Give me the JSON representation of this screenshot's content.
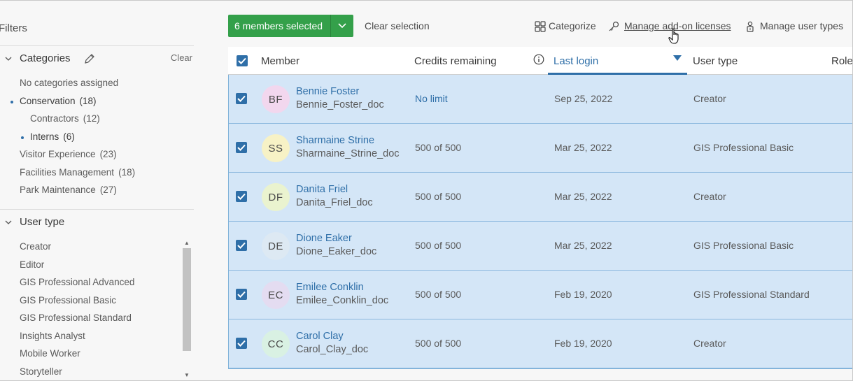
{
  "sidebar": {
    "filters_title": "Filters",
    "categories": {
      "title": "Categories",
      "clear": "Clear",
      "items": [
        {
          "label": "No categories assigned",
          "count": ""
        },
        {
          "label": "Conservation",
          "count": "(18)"
        },
        {
          "label": "Contractors",
          "count": "(12)"
        },
        {
          "label": "Interns",
          "count": "(6)"
        },
        {
          "label": "Visitor Experience",
          "count": "(23)"
        },
        {
          "label": "Facilities Management",
          "count": "(18)"
        },
        {
          "label": "Park Maintenance",
          "count": "(27)"
        }
      ]
    },
    "user_type": {
      "title": "User type",
      "items": [
        "Creator",
        "Editor",
        "GIS Professional Advanced",
        "GIS Professional Basic",
        "GIS Professional Standard",
        "Insights Analyst",
        "Mobile Worker",
        "Storyteller"
      ]
    }
  },
  "toolbar": {
    "selected_label": "6 members selected",
    "clear_selection": "Clear selection",
    "categorize": "Categorize",
    "manage_addon": "Manage add-on licenses",
    "manage_user_types": "Manage user types"
  },
  "table": {
    "headers": {
      "member": "Member",
      "credits": "Credits remaining",
      "last_login": "Last login",
      "user_type": "User type",
      "role": "Role"
    },
    "rows": [
      {
        "initials": "BF",
        "name": "Bennie Foster",
        "username": "Bennie_Foster_doc",
        "credits": "No limit",
        "last_login": "Sep 25, 2022",
        "user_type": "Creator",
        "avatar_color": "#f2d7ee"
      },
      {
        "initials": "SS",
        "name": "Sharmaine Strine",
        "username": "Sharmaine_Strine_doc",
        "credits": "500 of 500",
        "last_login": "Mar 25, 2022",
        "user_type": "GIS Professional Basic",
        "avatar_color": "#f7f2c6"
      },
      {
        "initials": "DF",
        "name": "Danita Friel",
        "username": "Danita_Friel_doc",
        "credits": "500 of 500",
        "last_login": "Mar 25, 2022",
        "user_type": "Creator",
        "avatar_color": "#eaf3cf"
      },
      {
        "initials": "DE",
        "name": "Dione Eaker",
        "username": "Dione_Eaker_doc",
        "credits": "500 of 500",
        "last_login": "Mar 25, 2022",
        "user_type": "GIS Professional Basic",
        "avatar_color": "#dde9f3"
      },
      {
        "initials": "EC",
        "name": "Emilee Conklin",
        "username": "Emilee_Conklin_doc",
        "credits": "500 of 500",
        "last_login": "Feb 19, 2020",
        "user_type": "GIS Professional Standard",
        "avatar_color": "#e4dcf1"
      },
      {
        "initials": "CC",
        "name": "Carol Clay",
        "username": "Carol_Clay_doc",
        "credits": "500 of 500",
        "last_login": "Feb 19, 2020",
        "user_type": "Creator",
        "avatar_color": "#d9f1e3"
      }
    ]
  },
  "colors": {
    "accent": "#2f6fa8",
    "primary_button": "#34a04a",
    "row_selected": "#d4e6f7"
  }
}
